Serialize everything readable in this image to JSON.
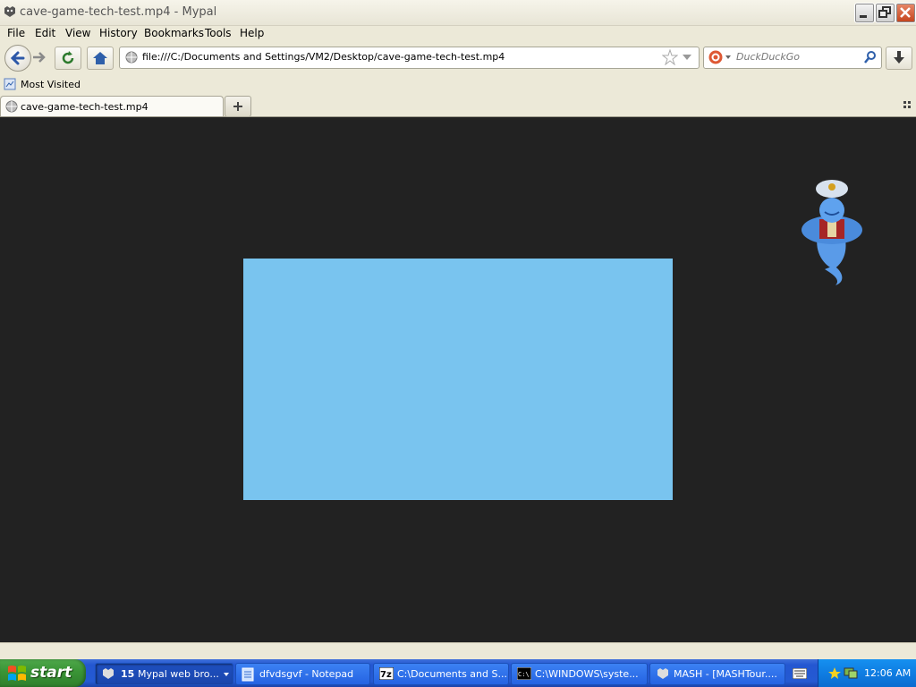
{
  "window": {
    "title": "cave-game-tech-test.mp4 - Mypal"
  },
  "menu": [
    "File",
    "Edit",
    "View",
    "History",
    "Bookmarks",
    "Tools",
    "Help"
  ],
  "navbar": {
    "url": "file:///C:/Documents and Settings/VM2/Desktop/cave-game-tech-test.mp4",
    "search_placeholder": "DuckDuckGo"
  },
  "bookmarks": {
    "most_visited": "Most Visited"
  },
  "tabs": [
    {
      "label": "cave-game-tech-test.mp4"
    }
  ],
  "video": {
    "color": "#79c4ef"
  },
  "taskbar": {
    "start_label": "start",
    "tasks": [
      {
        "count": "15",
        "label": "Mypal web bro...",
        "active": true
      },
      {
        "label": "dfvdsgvf - Notepad"
      },
      {
        "label": "C:\\Documents and S..."
      },
      {
        "label": "C:\\WINDOWS\\syste..."
      },
      {
        "label": "MASH - [MASHTour...."
      }
    ],
    "clock": "12:06 AM"
  }
}
